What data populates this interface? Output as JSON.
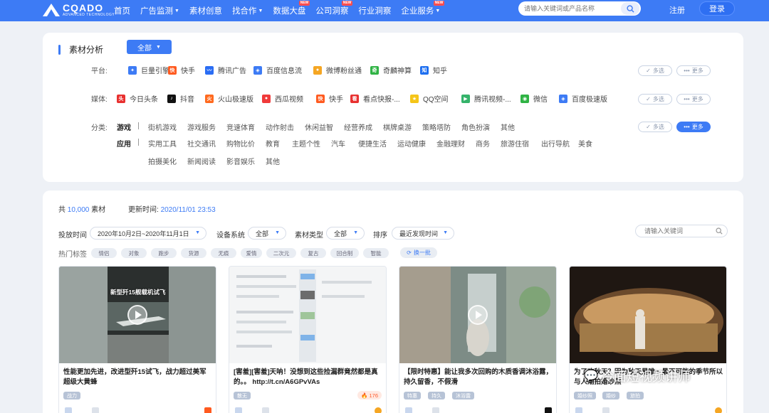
{
  "header": {
    "logo_text": "CQADO",
    "logo_sub": "ADVANCED TECHNOLOGY",
    "nav": [
      {
        "label": "首页",
        "caret": false,
        "new": false
      },
      {
        "label": "广告监测",
        "caret": true,
        "new": false
      },
      {
        "label": "素材创意",
        "caret": false,
        "new": false
      },
      {
        "label": "找合作",
        "caret": true,
        "new": false
      },
      {
        "label": "数据大盘",
        "caret": false,
        "new": true
      },
      {
        "label": "公司洞察",
        "caret": false,
        "new": true
      },
      {
        "label": "行业洞察",
        "caret": false,
        "new": false
      },
      {
        "label": "企业服务",
        "caret": false,
        "new": true
      }
    ],
    "new_badge": "NEW",
    "search_placeholder": "请输入关键词或产品名称",
    "register": "注册",
    "login": "登录"
  },
  "filters": {
    "section_title": "素材分析",
    "all_button": "全部",
    "platform_label": "平台:",
    "platforms": [
      {
        "label": "巨量引擎",
        "color": "#3d7bf5",
        "glyph": "✦"
      },
      {
        "label": "快手",
        "color": "#ff5a1f",
        "glyph": "快"
      },
      {
        "label": "腾讯广告",
        "color": "#2a6df4",
        "glyph": "〰"
      },
      {
        "label": "百度信息流",
        "color": "#3d7bf5",
        "glyph": "◈"
      },
      {
        "label": "微博粉丝通",
        "color": "#f5a623",
        "glyph": "●"
      },
      {
        "label": "奇麟神算",
        "color": "#2fb344",
        "glyph": "奇"
      },
      {
        "label": "知乎",
        "color": "#1e6ff0",
        "glyph": "知"
      }
    ],
    "media_label": "媒体:",
    "media": [
      {
        "label": "今日头条",
        "color": "#e8302f",
        "glyph": "头"
      },
      {
        "label": "抖音",
        "color": "#111111",
        "glyph": "♪"
      },
      {
        "label": "火山极速版",
        "color": "#ff6a1f",
        "glyph": "火"
      },
      {
        "label": "西瓜视频",
        "color": "#f03a3a",
        "glyph": "●"
      },
      {
        "label": "快手",
        "color": "#ff5a1f",
        "glyph": "快"
      },
      {
        "label": "看点快报-...",
        "color": "#e8302f",
        "glyph": "看"
      },
      {
        "label": "QQ空间",
        "color": "#f5c518",
        "glyph": "★"
      },
      {
        "label": "腾讯视频-...",
        "color": "#35b36a",
        "glyph": "▶"
      },
      {
        "label": "微信",
        "color": "#2fb344",
        "glyph": "◉"
      },
      {
        "label": "百度极速版",
        "color": "#3d7bf5",
        "glyph": "◈"
      }
    ],
    "category_label": "分类:",
    "category_games_label": "游戏",
    "games": [
      "街机游戏",
      "游戏服务",
      "竞速体育",
      "动作射击",
      "休闲益智",
      "经营养成",
      "棋牌桌游",
      "策略塔防",
      "角色扮演",
      "其他"
    ],
    "category_apps_label": "应用",
    "apps_row1": [
      "实用工具",
      "社交通讯",
      "购物比价",
      "教育",
      "主题个性",
      "汽车",
      "便捷生活",
      "运动健康",
      "金融理财",
      "商务",
      "旅游住宿",
      "出行导航",
      "美食"
    ],
    "apps_row2": [
      "拍摄美化",
      "新闻阅读",
      "影音娱乐",
      "其他"
    ],
    "multi_select": "多选",
    "more": "更多"
  },
  "results": {
    "total_prefix": "共",
    "total_count": "10,000",
    "total_suffix": "素材",
    "updated_label": "更新时间:",
    "updated_time": "2020/11/01 23:53",
    "launch_time_label": "投放时间",
    "launch_time_value": "2020年10月2日~2020年11月1日",
    "device_label": "设备系统",
    "device_value": "全部",
    "material_type_label": "素材类型",
    "material_type_value": "全部",
    "sort_label": "排序",
    "sort_value": "最近发现时间",
    "keyword_placeholder": "请输入关键词",
    "hot_tags_label": "热门标签",
    "hot_tags": [
      "情侣",
      "对象",
      "跑步",
      "货源",
      "无痕",
      "爱情",
      "二次元",
      "复古",
      "回合制",
      "智能"
    ],
    "refresh_label": "换一批",
    "cards": [
      {
        "title": "性能更加先进，改进型歼15试飞，战力超过美军超级大黄蜂",
        "overlay_text": "新型歼15舰载机试飞",
        "tags": [
          "战力"
        ],
        "hot": "",
        "video": true,
        "platform_color": "#ff5a1f"
      },
      {
        "title": "[害羞][害羞]天呐！没想到这些捡漏群竟然都是真的。。 http://t.cn/A6GPvVAs",
        "overlay_text": "",
        "tags": [
          "散无"
        ],
        "hot": "176",
        "video": false,
        "platform_color": "#f5a623"
      },
      {
        "title": "【限时特惠】能让我多次回购的木质香调沐浴露，持久留香，不假滑",
        "overlay_text": "",
        "tags": [
          "特惠",
          "持久",
          "沐浴露"
        ],
        "hot": "",
        "video": true,
        "platform_color": "#111111"
      },
      {
        "title": "为了欢秋天？因为秋天是唯一最不可能的季节所以与人潮拍婚纱照",
        "overlay_text": "",
        "tags": [
          "婚纱照",
          "婚纱",
          "旅拍"
        ],
        "hot": "",
        "video": false,
        "platform_color": "#f5a623"
      }
    ]
  },
  "watermark": "冷面短视频讲师"
}
